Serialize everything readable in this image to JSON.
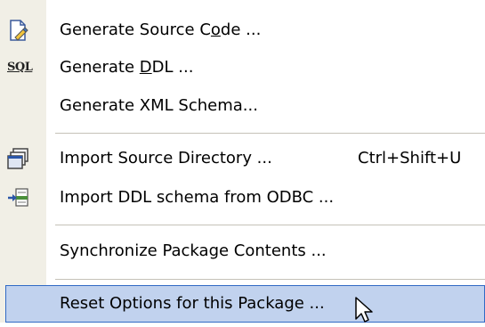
{
  "menu": {
    "items": [
      {
        "label_pre": "Generate Source C",
        "label_u": "o",
        "label_post": "de ...",
        "icon": "generate-code-icon",
        "shortcut": ""
      },
      {
        "label_pre": "Generate ",
        "label_u": "D",
        "label_post": "DL ...",
        "icon": "sql-icon",
        "icon_text": "SQL",
        "shortcut": ""
      },
      {
        "label": "Generate XML Schema...",
        "icon": "",
        "shortcut": ""
      },
      {
        "label": "Import Source Directory ...",
        "icon": "import-directory-icon",
        "shortcut": "Ctrl+Shift+U"
      },
      {
        "label": "Import DDL schema from ODBC ...",
        "icon": "import-odbc-icon",
        "shortcut": ""
      },
      {
        "label": "Synchronize Package Contents ...",
        "icon": "",
        "shortcut": ""
      },
      {
        "label": "Reset Options for this Package ...",
        "icon": "",
        "shortcut": "",
        "selected": true
      }
    ]
  },
  "colors": {
    "gutter": "#f1efe6",
    "highlight_fill": "#c1d2ee",
    "highlight_border": "#316ac5",
    "separator": "#c5c2b8"
  }
}
